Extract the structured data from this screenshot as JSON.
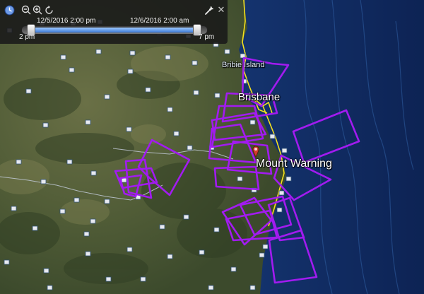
{
  "map": {
    "place_labels": {
      "bribie": "Bribie Island",
      "brisbane": "Brisbane",
      "mount_warning": "Mount Warning"
    },
    "colors": {
      "flight_tracks": "#a21bf0",
      "roads": "#f4e11e",
      "ocean": "#173a79",
      "land": "#55603a",
      "pin": "#d23b2e"
    },
    "marker_icon": "photo-thumbnail-icon",
    "pin_icon": "placemark-pin-icon"
  },
  "timeslider": {
    "start_time": "12/5/2016   2:00 pm",
    "end_time": "12/6/2016   2:00 am",
    "range_start": "2 pm",
    "range_end": "7 pm",
    "icons": {
      "clock": "clock-icon",
      "zoom_out": "zoom-out-icon",
      "zoom_in": "zoom-in-icon",
      "animate": "animation-options-icon",
      "settings": "wrench-icon",
      "close": "close-icon"
    },
    "close_glyph": "✕"
  }
}
